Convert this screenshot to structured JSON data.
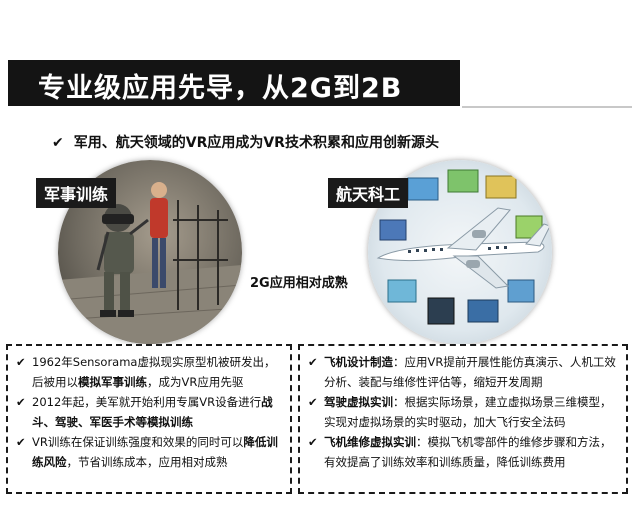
{
  "header": {
    "title": "专业级应用先导，从2G到2B"
  },
  "subtitle": {
    "check_icon": "check-icon",
    "text": "军用、航天领域的VR应用成为VR技术积累和应用创新源头"
  },
  "left_circle": {
    "tag": "军事训练"
  },
  "right_circle": {
    "tag": "航天科工"
  },
  "center_caption": "2G应用相对成熟",
  "left_panel": {
    "items": [
      {
        "lines": [
          {
            "text": "1962年Sensorama虚拟现实原型机被研发出，",
            "bold": false
          },
          {
            "text": "后被用以",
            "bold": false
          },
          {
            "text": "模拟军事训练",
            "bold": true
          },
          {
            "text": "，成为VR应用先驱",
            "bold": false
          }
        ]
      },
      {
        "lines": [
          {
            "text": "2012年起，美军就开始利用专属VR设备进行",
            "bold": false
          },
          {
            "text": "战斗、驾驶、军医手术等模拟训练",
            "bold": true
          }
        ]
      },
      {
        "lines": [
          {
            "text": "VR训练在保证训练强度和效果的同时可以",
            "bold": false
          },
          {
            "text": "降低训练风险",
            "bold": true
          },
          {
            "text": "，节省训练成本，应用相对成熟",
            "bold": false
          }
        ]
      }
    ]
  },
  "right_panel": {
    "items": [
      {
        "lines": [
          {
            "text": "飞机设计制造",
            "bold": true
          },
          {
            "text": "：应用VR提前开展性能仿真演示、人机工效分析、装配与维修性评估等，缩短开发周期",
            "bold": false
          }
        ]
      },
      {
        "lines": [
          {
            "text": "驾驶虚拟实训",
            "bold": true
          },
          {
            "text": "：根据实际场景，建立虚拟场景三维模型，实现对虚拟场景的实时驱动，加大飞行安全法码",
            "bold": false
          }
        ]
      },
      {
        "lines": [
          {
            "text": "飞机维修虚拟实训",
            "bold": true
          },
          {
            "text": "：模拟飞机零部件的维修步骤和方法，有效提高了训练效率和训练质量，降低训练费用",
            "bold": false
          }
        ]
      }
    ]
  },
  "colors": {
    "title_bar": "#141414",
    "title_text": "#ffffff",
    "panel_border": "#1a1a1a"
  }
}
